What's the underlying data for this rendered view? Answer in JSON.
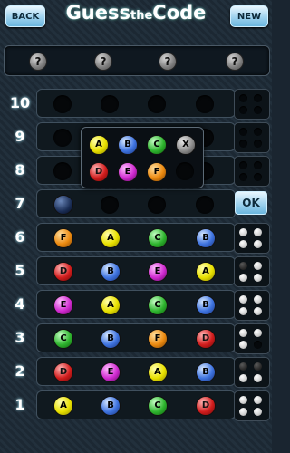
{
  "header": {
    "back_label": "BACK",
    "new_label": "NEW",
    "title_big1": "Guess",
    "title_small": "the",
    "title_big2": "Code"
  },
  "secret": {
    "slots": [
      "?",
      "?",
      "?",
      "?"
    ]
  },
  "rows": [
    {
      "num": "10",
      "pegs": [
        "",
        "",
        "",
        ""
      ],
      "feedback": [
        "empty",
        "empty",
        "empty",
        "empty"
      ]
    },
    {
      "num": "9",
      "pegs": [
        "",
        "",
        "",
        ""
      ],
      "feedback": [
        "empty",
        "empty",
        "empty",
        "empty"
      ]
    },
    {
      "num": "8",
      "pegs": [
        "",
        "",
        "",
        ""
      ],
      "feedback": [
        "empty",
        "empty",
        "empty",
        "empty"
      ]
    },
    {
      "num": "7",
      "pegs": [
        "dark",
        "",
        "",
        ""
      ],
      "feedback": []
    },
    {
      "num": "6",
      "pegs": [
        "F",
        "A",
        "C",
        "B"
      ],
      "feedback": [
        "white",
        "white",
        "white",
        "white"
      ]
    },
    {
      "num": "5",
      "pegs": [
        "D",
        "B",
        "E",
        "A"
      ],
      "feedback": [
        "gray",
        "white",
        "white",
        "white"
      ]
    },
    {
      "num": "4",
      "pegs": [
        "E",
        "A",
        "C",
        "B"
      ],
      "feedback": [
        "white",
        "white",
        "white",
        "white"
      ]
    },
    {
      "num": "3",
      "pegs": [
        "C",
        "B",
        "F",
        "D"
      ],
      "feedback": [
        "white",
        "white",
        "white",
        "empty"
      ]
    },
    {
      "num": "2",
      "pegs": [
        "D",
        "E",
        "A",
        "B"
      ],
      "feedback": [
        "gray",
        "gray",
        "white",
        "white"
      ]
    },
    {
      "num": "1",
      "pegs": [
        "A",
        "B",
        "C",
        "D"
      ],
      "feedback": [
        "white",
        "white",
        "white",
        "white"
      ]
    }
  ],
  "ok_label": "OK",
  "picker": {
    "options": [
      "A",
      "B",
      "C",
      "X",
      "D",
      "E",
      "F",
      ""
    ]
  }
}
